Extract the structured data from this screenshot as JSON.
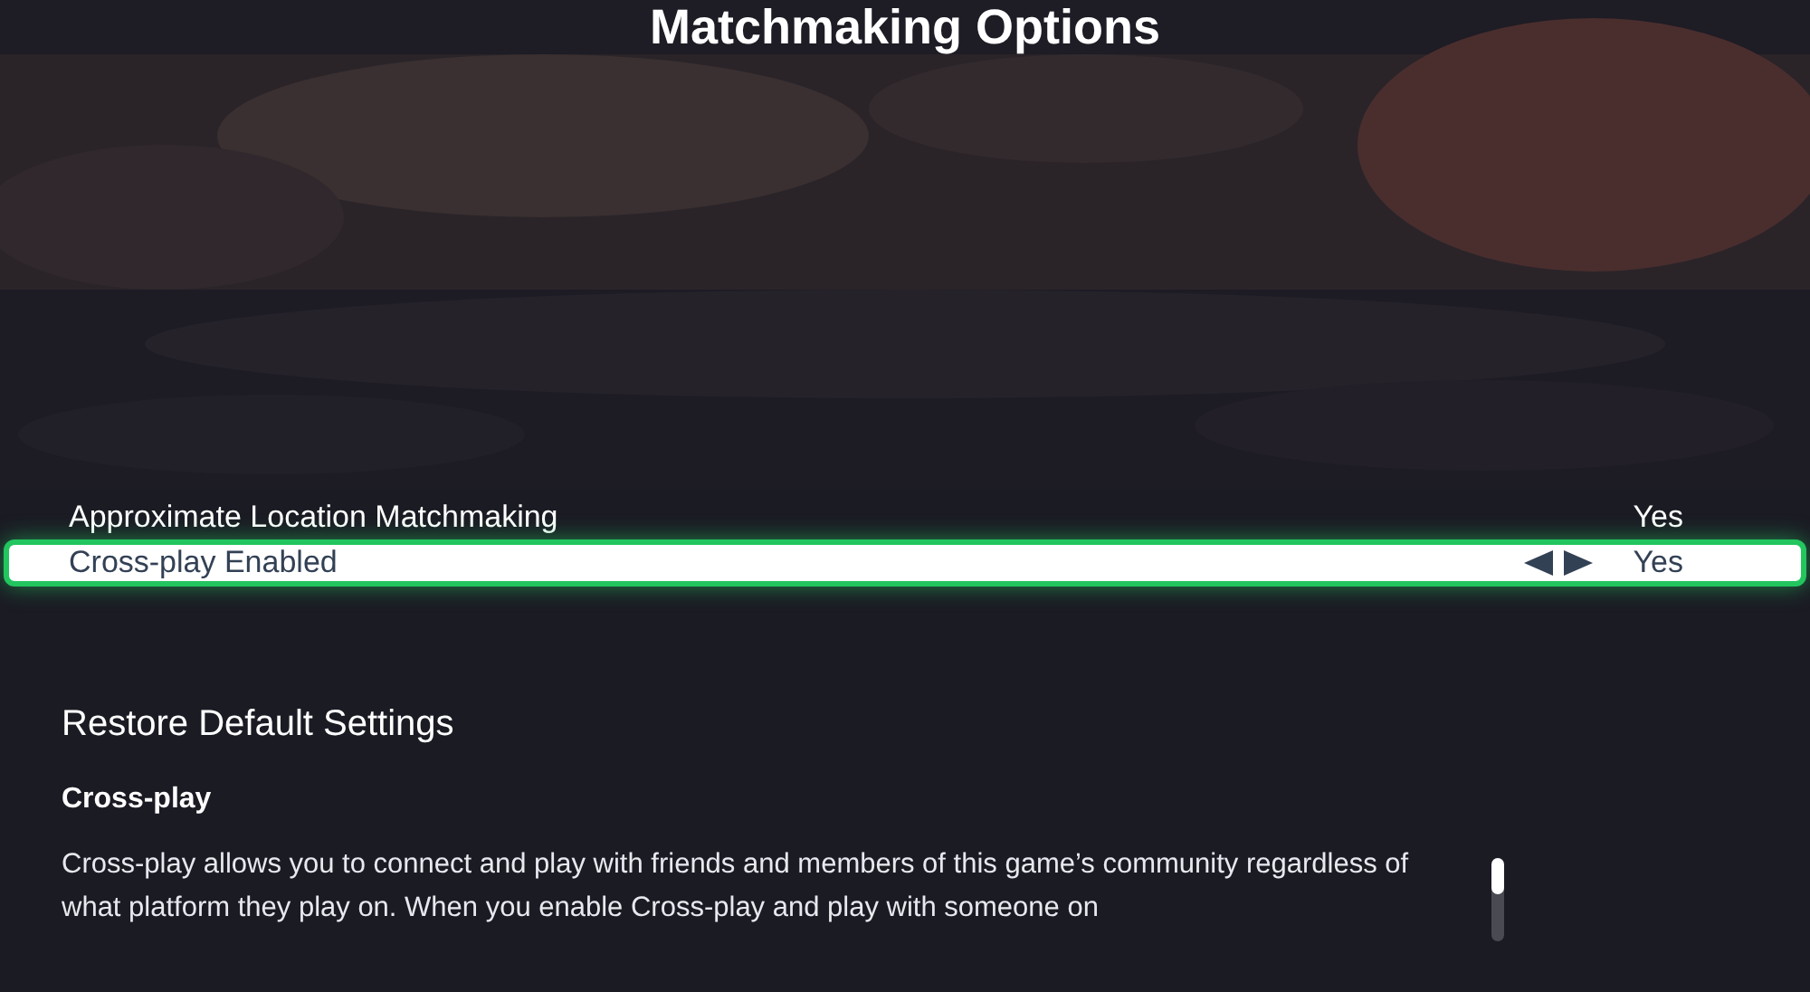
{
  "title": "Matchmaking Options",
  "options": [
    {
      "label": "Approximate Location Matchmaking",
      "value": "Yes",
      "selected": false
    },
    {
      "label": "Cross-play Enabled",
      "value": "Yes",
      "selected": true
    }
  ],
  "restore_button": "Restore Default Settings",
  "description": {
    "heading": "Cross-play",
    "text": "Cross-play allows you to connect and play with friends and members of this game’s community regardless of what platform they play on. When you enable Cross-play and play with someone on"
  }
}
